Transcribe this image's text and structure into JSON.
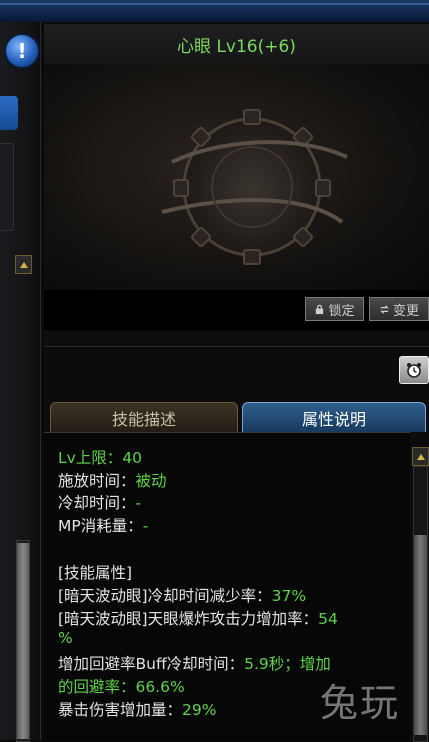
{
  "skill": {
    "title": "心眼 Lv16(+6)"
  },
  "toolbar": {
    "lock_label": "锁定",
    "change_label": "变更"
  },
  "tabs": [
    {
      "label": "技能描述",
      "active": false
    },
    {
      "label": "属性说明",
      "active": true
    }
  ],
  "attributes": {
    "lv_cap_label": "Lv上限：",
    "lv_cap_value": "40",
    "cast_time_label": "施放时间：",
    "cast_time_value": "被动",
    "cooldown_label": "冷却时间：",
    "cooldown_value": "-",
    "mp_label": "MP消耗量：",
    "mp_value": "-",
    "section_header": "[技能属性]",
    "line1_label": "[暗天波动眼]冷却时间减少率：",
    "line1_value": "37%",
    "line2_label": "[暗天波动眼]天眼爆炸攻击力增加率：",
    "line2_value_a": "54",
    "line2_value_b": "%",
    "line3_label": "增加回避率Buff冷却时间：",
    "line3_value": "5.9秒；增加",
    "line4_value": "的回避率：66.6%",
    "line5_label": "暴击伤害增加量：",
    "line5_value": "29%"
  },
  "watermark": {
    "text": "兔玩"
  },
  "icons": {
    "info": "info-icon",
    "lock": "lock-icon",
    "change": "swap-icon",
    "clock": "alarm-clock-icon"
  },
  "colors": {
    "title_green": "#7ad85b",
    "value_green": "#5fd34a",
    "active_tab_blue": "#2f5f8d"
  }
}
